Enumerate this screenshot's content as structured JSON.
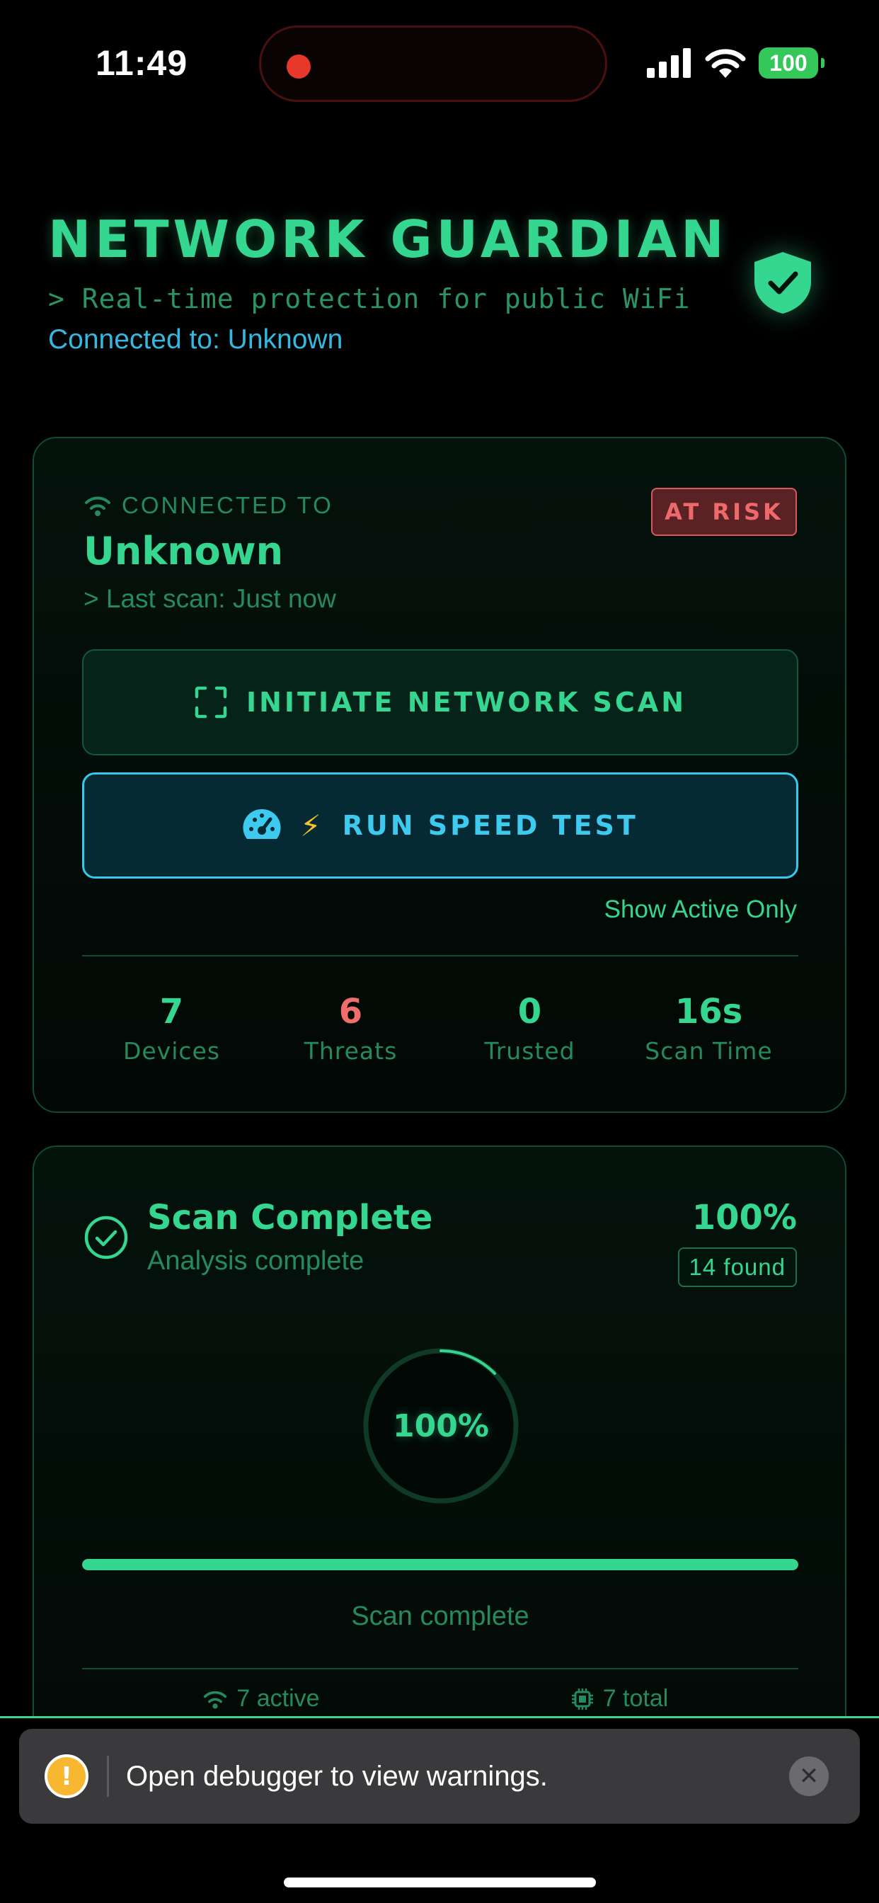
{
  "status_bar": {
    "time": "11:49",
    "battery": "100",
    "icons": [
      "signal-icon",
      "wifi-icon",
      "battery-icon"
    ]
  },
  "header": {
    "title": "NETWORK GUARDIAN",
    "subtitle": "> Real-time protection for public WiFi",
    "connected": "Connected to: Unknown",
    "icon": "shield-check-icon"
  },
  "network_card": {
    "connected_label": "CONNECTED TO",
    "network_name": "Unknown",
    "last_scan": "> Last scan: Just now",
    "risk_badge": "AT RISK",
    "scan_button": "INITIATE NETWORK SCAN",
    "speed_button": "RUN SPEED TEST",
    "speed_emoji": "⚡",
    "show_active": "Show Active Only",
    "stats": [
      {
        "value": "7",
        "label": "Devices"
      },
      {
        "value": "6",
        "label": "Threats"
      },
      {
        "value": "0",
        "label": "Trusted"
      },
      {
        "value": "16s",
        "label": "Scan Time"
      }
    ]
  },
  "scan_card": {
    "title": "Scan Complete",
    "subtitle": "Analysis complete",
    "percent": "100%",
    "found": "14 found",
    "ring_label": "100%",
    "progress": 1.0,
    "progress_text": "Scan complete",
    "active": "7 active",
    "total": "7 total"
  },
  "toast": {
    "message": "Open debugger to view warnings.",
    "warn_glyph": "!",
    "close_glyph": "✕"
  },
  "colors": {
    "accent": "#35d690",
    "accent_dim": "#268a5e",
    "danger": "#ef6d6d",
    "info": "#3ec9ee",
    "background": "#000000"
  }
}
